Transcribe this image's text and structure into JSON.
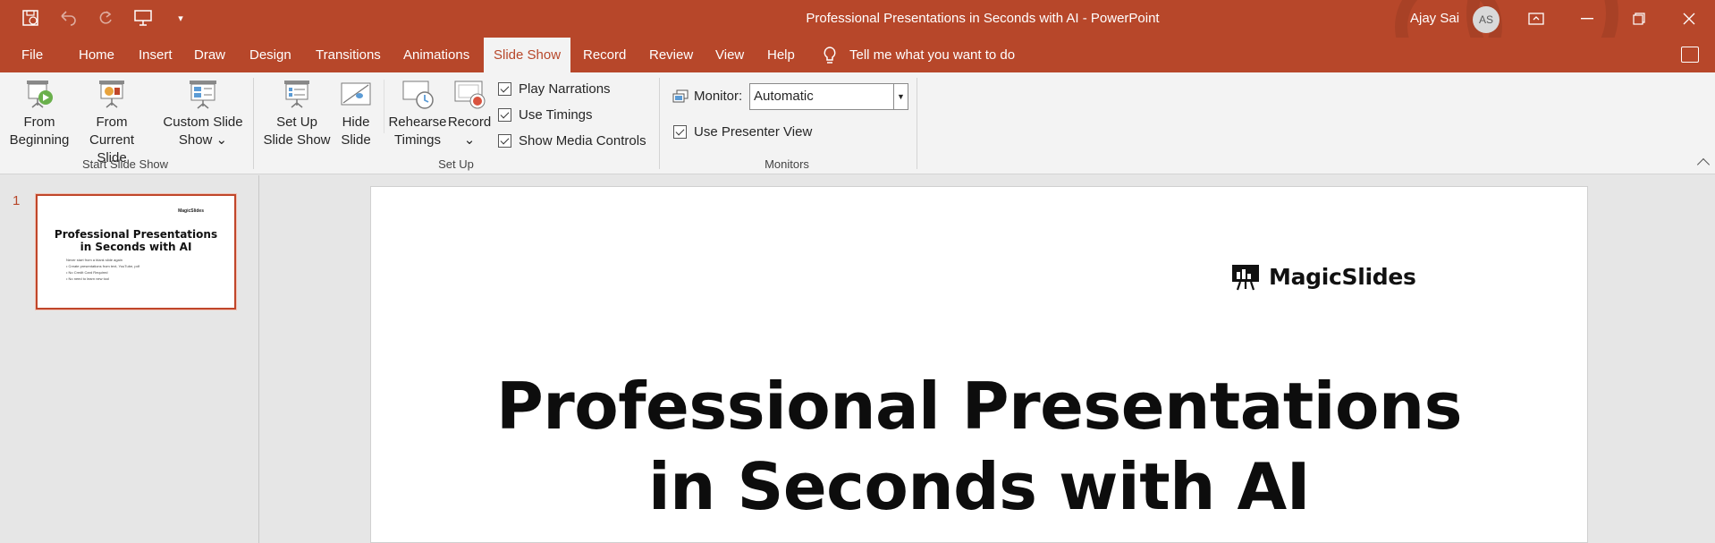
{
  "window": {
    "title": "Professional Presentations in Seconds with AI  -  PowerPoint",
    "user_name": "Ajay Sai",
    "user_initials": "AS"
  },
  "tabs": [
    {
      "label": "File"
    },
    {
      "label": "Home"
    },
    {
      "label": "Insert"
    },
    {
      "label": "Draw"
    },
    {
      "label": "Design"
    },
    {
      "label": "Transitions"
    },
    {
      "label": "Animations"
    },
    {
      "label": "Slide Show"
    },
    {
      "label": "Record"
    },
    {
      "label": "Review"
    },
    {
      "label": "View"
    },
    {
      "label": "Help"
    }
  ],
  "active_tab": "Slide Show",
  "tell_me": "Tell me what you want to do",
  "ribbon": {
    "start": {
      "from_beginning": [
        "From",
        "Beginning"
      ],
      "from_current": [
        "From",
        "Current Slide"
      ],
      "custom": [
        "Custom Slide",
        "Show ⌄"
      ],
      "label": "Start Slide Show"
    },
    "setup": {
      "setup_show": [
        "Set Up",
        "Slide Show"
      ],
      "hide_slide": [
        "Hide",
        "Slide"
      ],
      "rehearse": [
        "Rehearse",
        "Timings"
      ],
      "record": [
        "Record",
        "⌄"
      ],
      "play_narrations": "Play Narrations",
      "use_timings": "Use Timings",
      "show_media_controls": "Show Media Controls",
      "label": "Set Up"
    },
    "monitors": {
      "monitor_label": "Monitor:",
      "monitor_value": "Automatic",
      "presenter_view": "Use Presenter View",
      "label": "Monitors"
    }
  },
  "thumbnails": {
    "number": "1",
    "title": [
      "Professional Presentations",
      "in Seconds with AI"
    ],
    "logo": "MagicSlides",
    "bullets": [
      "Never start from a blank slide again",
      "• Create presentations from text, YouTube, pdf",
      "• No Credit Card Required",
      "• No need to learn new tool"
    ]
  },
  "slide": {
    "logo": "MagicSlides",
    "title_line1": "Professional Presentations",
    "title_line2": "in Seconds with AI"
  },
  "colors": {
    "accent": "#b7472a",
    "ribbon_bg": "#f3f3f3",
    "workspace_bg": "#e6e6e6"
  }
}
